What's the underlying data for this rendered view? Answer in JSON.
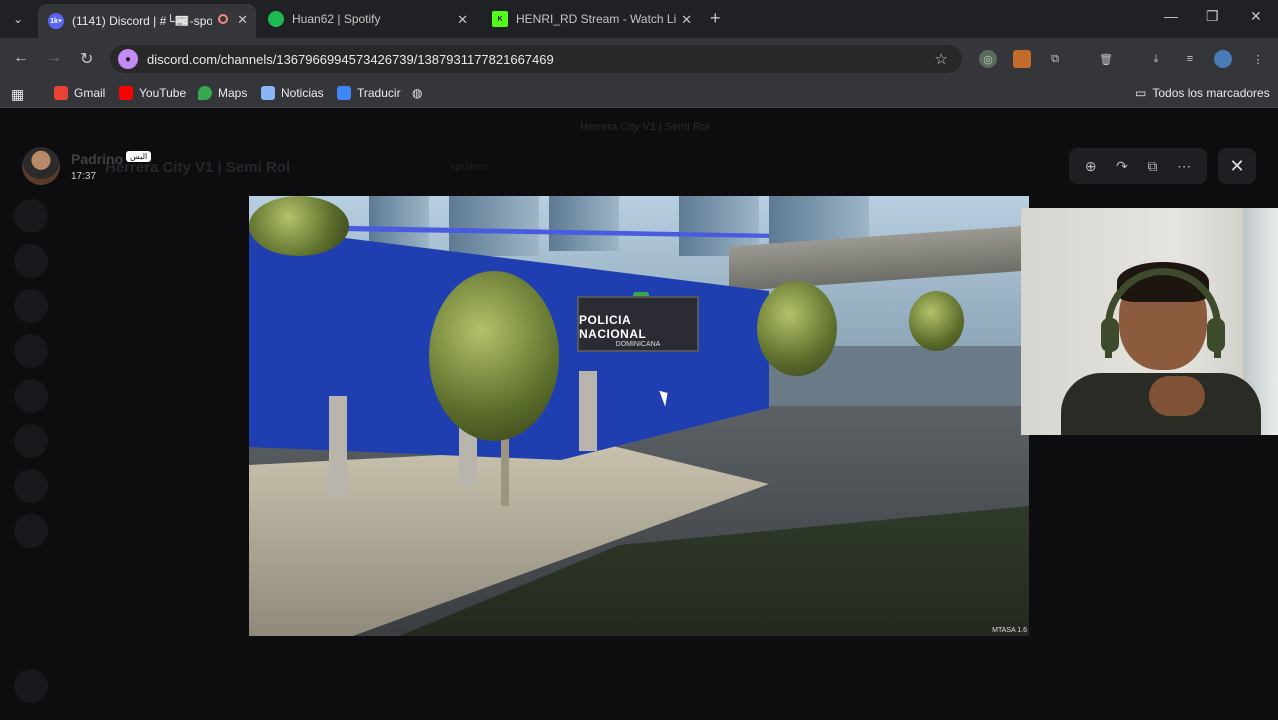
{
  "browser": {
    "tabs": [
      {
        "title": "(1141) Discord | #└📰-spo",
        "active": true,
        "favicon": "discord-icon",
        "favicon_text": "1k+"
      },
      {
        "title": "Huan62 | Spotify",
        "active": false,
        "favicon": "spotify-icon"
      },
      {
        "title": "HENRI_RD Stream - Watch Live",
        "active": false,
        "favicon": "kick-icon"
      }
    ],
    "url": "discord.com/channels/1367966994573426739/1387931177821667469",
    "bookmarks": [
      {
        "label": "Gmail",
        "icon": "gmail-icon",
        "color": "#ea4335"
      },
      {
        "label": "YouTube",
        "icon": "youtube-icon",
        "color": "#ff0000"
      },
      {
        "label": "Maps",
        "icon": "maps-icon",
        "color": "#34a853"
      },
      {
        "label": "Noticias",
        "icon": "news-icon",
        "color": "#8ab4f8"
      },
      {
        "label": "Traducir",
        "icon": "translate-icon",
        "color": "#4285f4"
      }
    ],
    "all_bookmarks": "Todos los marcadores"
  },
  "discord": {
    "window_title": "Herrera City V1 | Semi Rol",
    "server_name": "Herrera City V1 | Semi Rol",
    "channel": "spoilers"
  },
  "viewer": {
    "poster_name": "Padrino",
    "poster_badge": "البس",
    "post_time": "17:37"
  },
  "image": {
    "sign_line1": "POLICIA NACIONAL",
    "sign_line2": "DOMINICANA",
    "watermark": "MTASA 1.6"
  },
  "colors": {
    "chrome_dark": "#202124",
    "chrome_toolbar": "#35363a",
    "discord_accent": "#5865f2",
    "building_blue": "#1f3fb0"
  }
}
